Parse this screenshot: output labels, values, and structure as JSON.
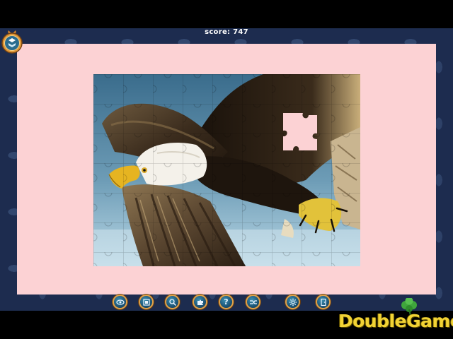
{
  "hud": {
    "score_text": "score: 747"
  },
  "menu": {
    "icon": "dropbox-box-icon"
  },
  "puzzle": {
    "subject": "bald eagle in flight",
    "board_color": "#fcd2d4",
    "frame_color": "#1d2c4f",
    "missing_piece": true
  },
  "toolbar": {
    "buttons": [
      {
        "name": "eye-icon"
      },
      {
        "name": "background-icon"
      },
      {
        "name": "magnify-icon"
      },
      {
        "name": "puzzle-piece-icon"
      },
      {
        "name": "help-icon",
        "glyph": "?"
      },
      {
        "name": "shuffle-icon"
      },
      {
        "name": "gear-icon"
      },
      {
        "name": "exit-door-icon"
      }
    ],
    "button_accent": "#e0a24a"
  },
  "watermark": {
    "text": "DoubleGames",
    "color": "#f2d335"
  }
}
